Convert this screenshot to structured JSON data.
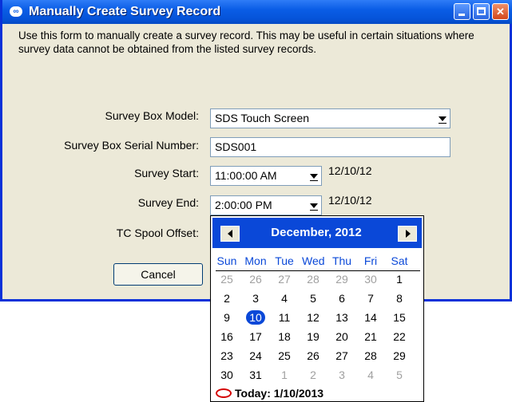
{
  "window": {
    "title": "Manually Create Survey Record",
    "icon": "sds-logo-icon",
    "controls": {
      "minimize": "minimize-icon",
      "maximize": "maximize-icon",
      "close": "✕"
    }
  },
  "intro_text": "Use this form to manually create a survey record.  This may be useful in certain situations where survey data cannot be obtained from the listed survey records.",
  "form": {
    "model_label": "Survey Box Model:",
    "model_value": "SDS Touch Screen",
    "serial_label": "Survey Box Serial Number:",
    "serial_value": "SDS001",
    "start_label": "Survey Start:",
    "start_time": "11:00:00 AM",
    "start_date": "12/10/12",
    "end_label": "Survey End:",
    "end_time": "2:00:00 PM",
    "end_date": "12/10/12",
    "offset_label": "TC Spool Offset:",
    "cancel_label": "Cancel"
  },
  "calendar": {
    "month_title": "December, 2012",
    "weekdays": [
      "Sun",
      "Mon",
      "Tue",
      "Wed",
      "Thu",
      "Fri",
      "Sat"
    ],
    "weeks": [
      [
        {
          "d": "25",
          "o": true
        },
        {
          "d": "26",
          "o": true
        },
        {
          "d": "27",
          "o": true
        },
        {
          "d": "28",
          "o": true
        },
        {
          "d": "29",
          "o": true
        },
        {
          "d": "30",
          "o": true
        },
        {
          "d": "1",
          "o": false
        }
      ],
      [
        {
          "d": "2",
          "o": false
        },
        {
          "d": "3",
          "o": false
        },
        {
          "d": "4",
          "o": false
        },
        {
          "d": "5",
          "o": false
        },
        {
          "d": "6",
          "o": false
        },
        {
          "d": "7",
          "o": false
        },
        {
          "d": "8",
          "o": false
        }
      ],
      [
        {
          "d": "9",
          "o": false
        },
        {
          "d": "10",
          "o": false,
          "sel": true
        },
        {
          "d": "11",
          "o": false
        },
        {
          "d": "12",
          "o": false
        },
        {
          "d": "13",
          "o": false
        },
        {
          "d": "14",
          "o": false
        },
        {
          "d": "15",
          "o": false
        }
      ],
      [
        {
          "d": "16",
          "o": false
        },
        {
          "d": "17",
          "o": false
        },
        {
          "d": "18",
          "o": false
        },
        {
          "d": "19",
          "o": false
        },
        {
          "d": "20",
          "o": false
        },
        {
          "d": "21",
          "o": false
        },
        {
          "d": "22",
          "o": false
        }
      ],
      [
        {
          "d": "23",
          "o": false
        },
        {
          "d": "24",
          "o": false
        },
        {
          "d": "25",
          "o": false
        },
        {
          "d": "26",
          "o": false
        },
        {
          "d": "27",
          "o": false
        },
        {
          "d": "28",
          "o": false
        },
        {
          "d": "29",
          "o": false
        }
      ],
      [
        {
          "d": "30",
          "o": false
        },
        {
          "d": "31",
          "o": false
        },
        {
          "d": "1",
          "o": true
        },
        {
          "d": "2",
          "o": true
        },
        {
          "d": "3",
          "o": true
        },
        {
          "d": "4",
          "o": true
        },
        {
          "d": "5",
          "o": true
        }
      ]
    ],
    "today_text": "Today: 1/10/2013"
  }
}
